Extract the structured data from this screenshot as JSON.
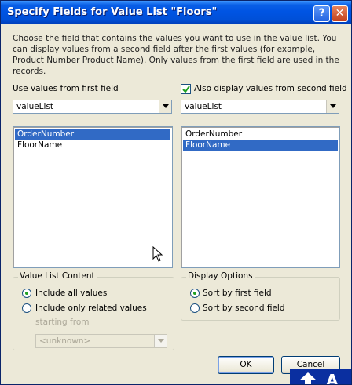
{
  "window": {
    "title": "Specify Fields for Value List \"Floors\"",
    "help_label": "?",
    "close_label": "✕"
  },
  "description": "Choose the field that contains the values you want to use in the value list. You can display values from a second field after the first values (for example, Product Number Product Name). Only values from the first field are used in the records.",
  "first_field": {
    "label": "Use values from first field",
    "table": "valueList",
    "items": [
      "OrderNumber",
      "FloorName"
    ],
    "selected": "OrderNumber"
  },
  "second_field": {
    "checkbox_label": "Also display values from second field",
    "checked": true,
    "table": "valueList",
    "items": [
      "OrderNumber",
      "FloorName"
    ],
    "selected": "FloorName"
  },
  "value_list_content": {
    "legend": "Value List Content",
    "include_all": "Include all values",
    "include_related": "Include only related values",
    "starting_from": "starting from",
    "starting_from_value": "<unknown>",
    "selected": "Include all values"
  },
  "display_options": {
    "legend": "Display Options",
    "sort_first": "Sort by first field",
    "sort_second": "Sort by second field",
    "selected": "Sort by first field"
  },
  "buttons": {
    "ok": "OK",
    "cancel": "Cancel"
  },
  "overlay": {
    "letter": "A"
  },
  "colors": {
    "title_bar": "#0054e3",
    "selection": "#316ac5",
    "dialog_bg": "#ece9d8",
    "radio_dot": "#21a121"
  },
  "icons": [
    "help-icon",
    "close-icon",
    "dropdown-arrow-icon",
    "checkmark-icon",
    "mouse-cursor-icon",
    "up-arrow-icon"
  ]
}
